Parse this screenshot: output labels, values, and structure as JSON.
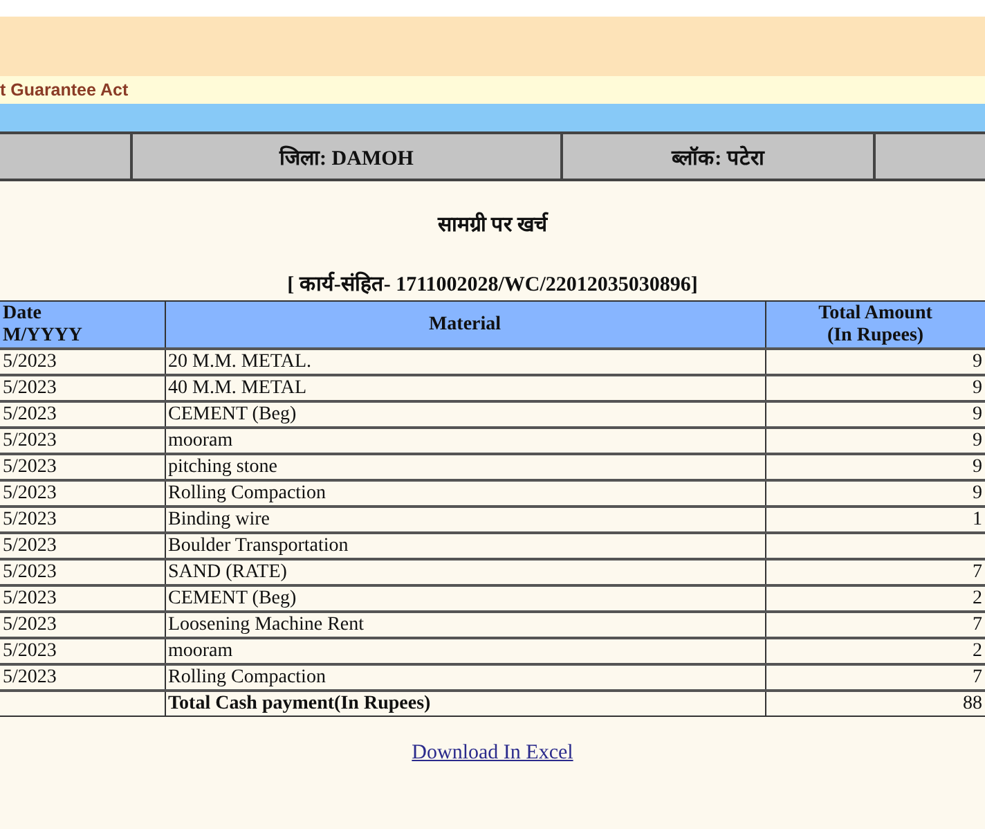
{
  "banner": {
    "subtitle": "t Guarantee Act"
  },
  "location_bar": {
    "cells": [
      "जिला: DAMOH",
      "ब्लॉक: पटेरा"
    ]
  },
  "report": {
    "title": "सामग्री पर खर्च",
    "work_code": "[ कार्य-संहित- 1711002028/WC/22012035030896]"
  },
  "table": {
    "columns": [
      "Date\nM/YYYY",
      "Material",
      "Total Amount\n(In Rupees)"
    ],
    "rows": [
      {
        "date": "5/2023",
        "material": "20 M.M. METAL.",
        "amount": "9"
      },
      {
        "date": "5/2023",
        "material": "40 M.M. METAL",
        "amount": "9"
      },
      {
        "date": "5/2023",
        "material": "CEMENT (Beg)",
        "amount": "9"
      },
      {
        "date": "5/2023",
        "material": "mooram",
        "amount": "9"
      },
      {
        "date": "5/2023",
        "material": "pitching stone",
        "amount": "9"
      },
      {
        "date": "5/2023",
        "material": "Rolling Compaction",
        "amount": "9"
      },
      {
        "date": "5/2023",
        "material": "Binding wire",
        "amount": "1"
      },
      {
        "date": "5/2023",
        "material": "Boulder Transportation",
        "amount": ""
      },
      {
        "date": "5/2023",
        "material": "SAND (RATE)",
        "amount": "7"
      },
      {
        "date": "5/2023",
        "material": "CEMENT (Beg)",
        "amount": "2"
      },
      {
        "date": "5/2023",
        "material": "Loosening Machine Rent",
        "amount": "7"
      },
      {
        "date": "5/2023",
        "material": "mooram",
        "amount": "2"
      },
      {
        "date": "5/2023",
        "material": "Rolling Compaction",
        "amount": "7"
      }
    ],
    "total": {
      "label": "Total Cash payment(In Rupees)",
      "amount": "88"
    }
  },
  "download_link": "Download In Excel"
}
